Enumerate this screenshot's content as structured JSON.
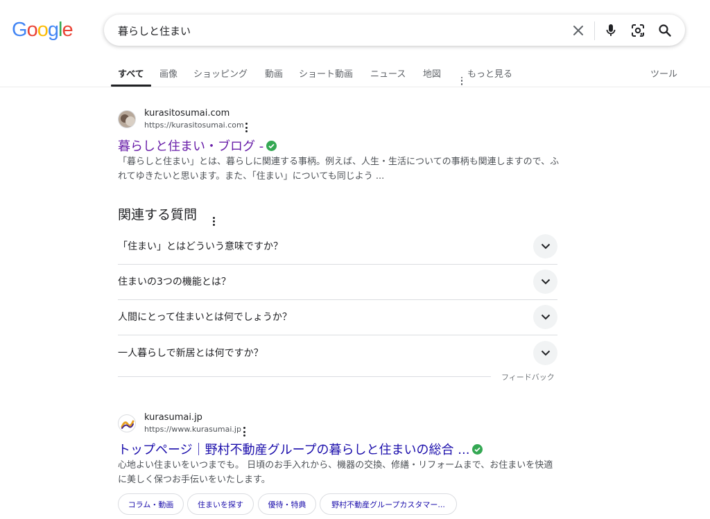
{
  "logo": {
    "text": "Google"
  },
  "search": {
    "query": "暮らしと住まい",
    "icons": [
      "close-icon",
      "microphone-icon",
      "google-lens-icon",
      "search-icon"
    ]
  },
  "tabs": [
    {
      "label": "すべて",
      "active": true
    },
    {
      "label": "画像"
    },
    {
      "label": "ショッピング"
    },
    {
      "label": "動画"
    },
    {
      "label": "ショート動画"
    },
    {
      "label": "ニュース"
    },
    {
      "label": "地図"
    },
    {
      "label": "もっと見る"
    }
  ],
  "tools_label": "ツール",
  "results": [
    {
      "site_name": "kurasitosumai.com",
      "url": "https://kurasitosumai.com",
      "title": "暮らしと住まい・ブログ -",
      "snippet": "「暮らしと住まい」とは、暮らしに関連する事柄。例えば、人生・生活についての事柄も関連しますので、ふれてゆきたいと思います。また、「住まい」についても同じよう ..."
    },
    {
      "site_name": "kurasumai.jp",
      "url": "https://www.kurasumai.jp",
      "title": "トップページ｜野村不動産グループの暮らしと住まいの総合 ...",
      "snippet": "心地よい住まいをいつまでも。 日頃のお手入れから、機器の交換、修繕・リフォームまで、お住まいを快適に美しく保つお手伝いをいたします。",
      "sitelinks": [
        "コラム・動画",
        "住まいを探す",
        "優待・特典",
        "野村不動産グループカスタマー..."
      ]
    }
  ],
  "paa": {
    "title": "関連する質問",
    "questions": [
      "「住まい」とはどういう意味ですか？",
      "住まいの3つの機能とは？",
      "人間にとって住まいとは何でしょうか？",
      "一人暮らしで新居とは何ですか？"
    ],
    "feedback": "フィードバック"
  },
  "colors": {
    "visited_link": "#681da8",
    "link": "#1a0dab",
    "verified": "#34a853"
  }
}
